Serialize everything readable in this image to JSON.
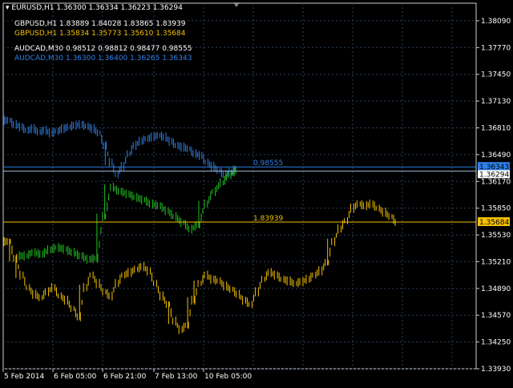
{
  "colors": {
    "background": "#000000",
    "grid": "#2b3f5a",
    "axis_text": "#ffffff",
    "eurusd": "#ffffff",
    "gbpusd": "#f5c000",
    "gbpusd_up": "#f5c000",
    "gbpusd_mid": "#22c322",
    "audcad": "#2f80e8",
    "bid_label_bg_white": "#ffffff",
    "bid_label_bg_gold": "#f5c000"
  },
  "legend": {
    "main": "EURUSD,H1  1.36300 1.36334 1.36223 1.36294",
    "gbpusd_white": "GBPUSD,H1  1.83889 1.84028 1.83865 1.83939",
    "gbpusd_gold": "GBPUSD,H1  1.35834 1.35773 1.35610 1.35684",
    "audcad_white": "AUDCAD,M30  0.98512 0.98812 0.98477 0.98555",
    "audcad_blue": "AUDCAD,M30  1.36300 1.36400 1.36265 1.36343"
  },
  "chart_data": {
    "type": "line",
    "symbol": "EURUSD,H1",
    "y_ticks": [
      "1.38090",
      "1.37770",
      "1.37450",
      "1.37130",
      "1.36810",
      "1.36490",
      "1.36170",
      "1.35850",
      "1.35530",
      "1.35210",
      "1.34890",
      "1.34570",
      "1.34250",
      "1.33930"
    ],
    "ylim": [
      1.3393,
      1.383
    ],
    "x_ticks": [
      "5 Feb 2014",
      "6 Feb 05:00",
      "6 Feb 21:00",
      "7 Feb 13:00",
      "10 Feb 05:00"
    ],
    "price_lines": [
      {
        "label": "0.98555",
        "price_tag": "1.36343",
        "price": 1.36343,
        "color": "#2f80e8"
      },
      {
        "label": "1.83939",
        "price_tag": "1.35684",
        "price": 1.35684,
        "color": "#f5c000"
      }
    ],
    "current_price_tag": "1.36294",
    "series": [
      {
        "color": "#2f80e8",
        "values": [
          1.369,
          1.3685,
          1.3682,
          1.3678,
          1.368,
          1.3676,
          1.3678,
          1.3675,
          1.3677,
          1.368,
          1.3682,
          1.3684,
          1.3685,
          1.3683,
          1.368,
          1.3675,
          1.366,
          1.364,
          1.3625,
          1.3635,
          1.365,
          1.366,
          1.3665,
          1.3668,
          1.367,
          1.3672,
          1.367,
          1.3665,
          1.366,
          1.3658,
          1.3656,
          1.365,
          1.3648,
          1.364,
          1.3635,
          1.363,
          1.3625,
          1.3628,
          1.3633
        ]
      },
      {
        "color": "#22c322",
        "values": [
          1.3528,
          1.3532,
          1.353,
          1.3535,
          1.3538,
          1.3536,
          1.3532,
          1.3528,
          1.3524,
          1.3525,
          1.3575,
          1.361,
          1.3605,
          1.3602,
          1.3598,
          1.3595,
          1.359,
          1.3588,
          1.3582,
          1.3575,
          1.3568,
          1.356,
          1.3565,
          1.359,
          1.3605,
          1.3615,
          1.3625,
          1.363
        ]
      },
      {
        "color": "#f5c000",
        "values": [
          1.3545,
          1.3525,
          1.3505,
          1.349,
          1.3482,
          1.3478,
          1.3485,
          1.349,
          1.348,
          1.3475,
          1.3465,
          1.3455,
          1.349,
          1.3505,
          1.3495,
          1.3485,
          1.348,
          1.3495,
          1.3505,
          1.3508,
          1.3512,
          1.3515,
          1.351,
          1.3495,
          1.348,
          1.347,
          1.345,
          1.344,
          1.3445,
          1.3475,
          1.3495,
          1.3505,
          1.35,
          1.3498,
          1.3492,
          1.3488,
          1.3482,
          1.3475,
          1.347,
          1.3485,
          1.35,
          1.3508,
          1.3505,
          1.35,
          1.3498,
          1.3495,
          1.3497,
          1.35,
          1.3505,
          1.351,
          1.352,
          1.3545,
          1.356,
          1.357,
          1.3585,
          1.359,
          1.3588,
          1.359,
          1.3585,
          1.358,
          1.3575,
          1.3568
        ]
      }
    ]
  }
}
